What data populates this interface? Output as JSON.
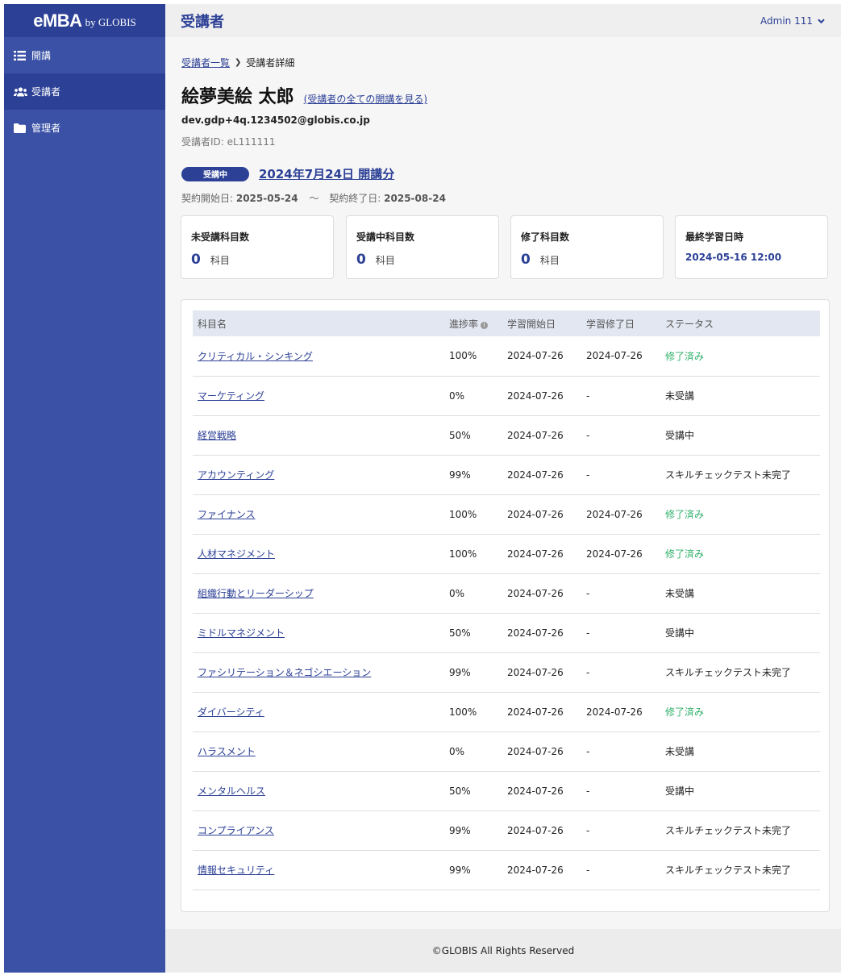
{
  "brand": {
    "main": "eMBA",
    "sub": "by GLOBIS"
  },
  "sidebar": {
    "items": [
      {
        "label": "開講",
        "icon": "list-icon",
        "active": false
      },
      {
        "label": "受講者",
        "icon": "users-icon",
        "active": true
      },
      {
        "label": "管理者",
        "icon": "folder-icon",
        "active": false
      }
    ]
  },
  "header": {
    "title": "受講者",
    "user": "Admin 111"
  },
  "breadcrumb": {
    "parent": "受講者一覧",
    "current": "受講者詳細"
  },
  "learner": {
    "name": "絵夢美絵 太郎",
    "all_courses_link": "(受講者の全ての開講を見る)",
    "email": "dev.gdp+4q.1234502@globis.co.jp",
    "id_text": "受講者ID: eL111111"
  },
  "course": {
    "status_badge": "受講中",
    "title": "2024年7月24日 開講分",
    "contract_start_label": "契約開始日: ",
    "contract_start": "2025-05-24",
    "separator": "〜",
    "contract_end_label": "契約終了日: ",
    "contract_end": "2025-08-24"
  },
  "stats": [
    {
      "label": "未受講科目数",
      "value": "0",
      "unit": "科目"
    },
    {
      "label": "受講中科目数",
      "value": "0",
      "unit": "科目"
    },
    {
      "label": "修了科目数",
      "value": "0",
      "unit": "科目"
    },
    {
      "label": "最終学習日時",
      "datetime": "2024-05-16 12:00"
    }
  ],
  "table": {
    "headers": [
      "科目名",
      "進捗率",
      "学習開始日",
      "学習修了日",
      "ステータス"
    ],
    "rows": [
      {
        "name": "クリティカル・シンキング",
        "progress": "100%",
        "start": "2024-07-26",
        "end": "2024-07-26",
        "status": "修了済み",
        "done": true
      },
      {
        "name": "マーケティング",
        "progress": "0%",
        "start": "2024-07-26",
        "end": "-",
        "status": "未受講",
        "done": false
      },
      {
        "name": "経営戦略",
        "progress": "50%",
        "start": "2024-07-26",
        "end": "-",
        "status": "受講中",
        "done": false
      },
      {
        "name": "アカウンティング",
        "progress": "99%",
        "start": "2024-07-26",
        "end": "-",
        "status": "スキルチェックテスト未完了",
        "done": false
      },
      {
        "name": "ファイナンス",
        "progress": "100%",
        "start": "2024-07-26",
        "end": "2024-07-26",
        "status": "修了済み",
        "done": true
      },
      {
        "name": "人材マネジメント",
        "progress": "100%",
        "start": "2024-07-26",
        "end": "2024-07-26",
        "status": "修了済み",
        "done": true
      },
      {
        "name": "組織行動とリーダーシップ",
        "progress": "0%",
        "start": "2024-07-26",
        "end": "-",
        "status": "未受講",
        "done": false
      },
      {
        "name": "ミドルマネジメント",
        "progress": "50%",
        "start": "2024-07-26",
        "end": "-",
        "status": "受講中",
        "done": false
      },
      {
        "name": "ファシリテーション＆ネゴシエーション",
        "progress": "99%",
        "start": "2024-07-26",
        "end": "-",
        "status": "スキルチェックテスト未完了",
        "done": false
      },
      {
        "name": "ダイバーシティ",
        "progress": "100%",
        "start": "2024-07-26",
        "end": "2024-07-26",
        "status": "修了済み",
        "done": true
      },
      {
        "name": "ハラスメント",
        "progress": "0%",
        "start": "2024-07-26",
        "end": "-",
        "status": "未受講",
        "done": false
      },
      {
        "name": "メンタルヘルス",
        "progress": "50%",
        "start": "2024-07-26",
        "end": "-",
        "status": "受講中",
        "done": false
      },
      {
        "name": "コンプライアンス",
        "progress": "99%",
        "start": "2024-07-26",
        "end": "-",
        "status": "スキルチェックテスト未完了",
        "done": false
      },
      {
        "name": "情報セキュリティ",
        "progress": "99%",
        "start": "2024-07-26",
        "end": "-",
        "status": "スキルチェックテスト未完了",
        "done": false
      }
    ]
  },
  "footer": {
    "text": "©GLOBIS All Rights Reserved"
  },
  "colors": {
    "brand": "#3a51a6",
    "brand_dark": "#2c4096",
    "done_status": "#2fb06a"
  }
}
